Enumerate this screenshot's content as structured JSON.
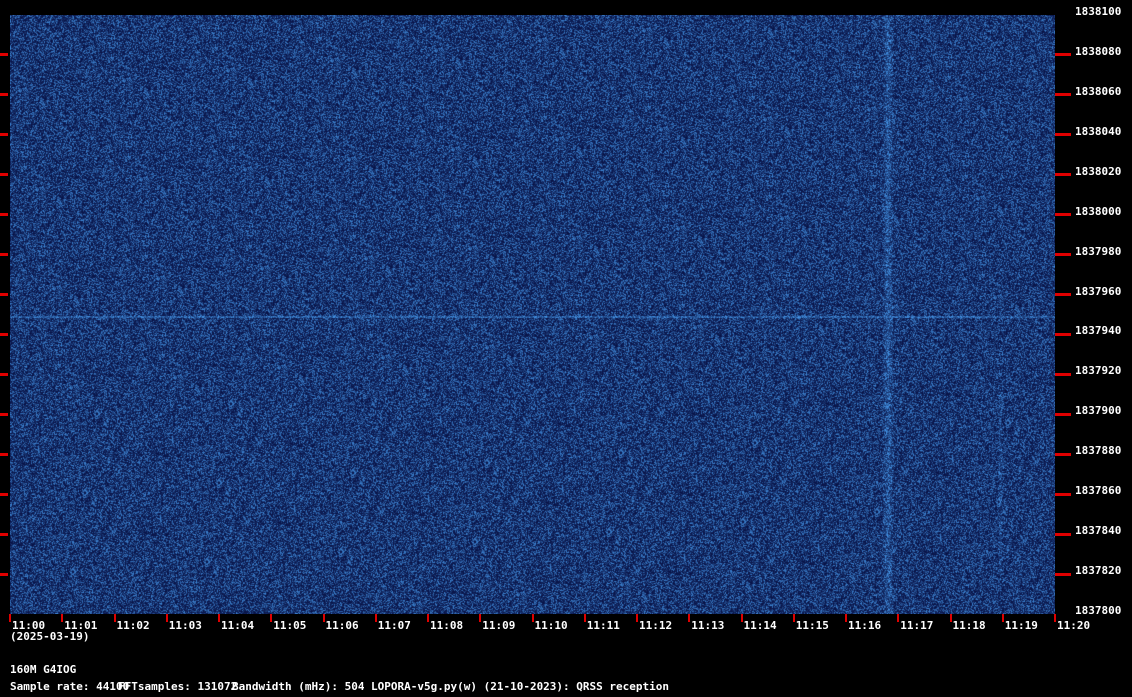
{
  "chart_data": {
    "type": "heatmap",
    "title": "160M G4IOG",
    "date": "(2025-03-19)",
    "x_ticks": [
      "11:00",
      "11:01",
      "11:02",
      "11:03",
      "11:04",
      "11:05",
      "11:06",
      "11:07",
      "11:08",
      "11:09",
      "11:10",
      "11:11",
      "11:12",
      "11:13",
      "11:14",
      "11:15",
      "11:16",
      "11:17",
      "11:18",
      "11:19",
      "11:20"
    ],
    "y_ticks": [
      "1838100",
      "1838080",
      "1838060",
      "1838040",
      "1838020",
      "1838000",
      "1837980",
      "1837960",
      "1837940",
      "1837920",
      "1837900",
      "1837880",
      "1837860",
      "1837840",
      "1837820",
      "1837800"
    ],
    "xlim_minutes": [
      0,
      20
    ],
    "ylim_hz": [
      1837800,
      1838100
    ],
    "signals": [
      {
        "kind": "horizontal-carrier",
        "freq_hz": 1837949,
        "from_min": 0,
        "to_min": 20
      },
      {
        "kind": "vertical-broadband",
        "time_min": 16.8,
        "from_hz": 1837800,
        "to_hz": 1838100
      },
      {
        "kind": "vertical-faint",
        "time_min": 18.95,
        "from_hz": 1837820,
        "to_hz": 1837910
      }
    ],
    "colors": {
      "background": "#000000",
      "noise": "#0a1a5a",
      "signal": "#5aa0e0",
      "tick": "#e00000"
    }
  },
  "footer": {
    "sample_rate": "Sample rate: 44100",
    "fft_samples": "FFTsamples: 131072",
    "bandwidth": "Bandwidth (mHz): 504",
    "software": "LOPORA-v5g.py(w) (21-10-2023): QRSS reception"
  }
}
